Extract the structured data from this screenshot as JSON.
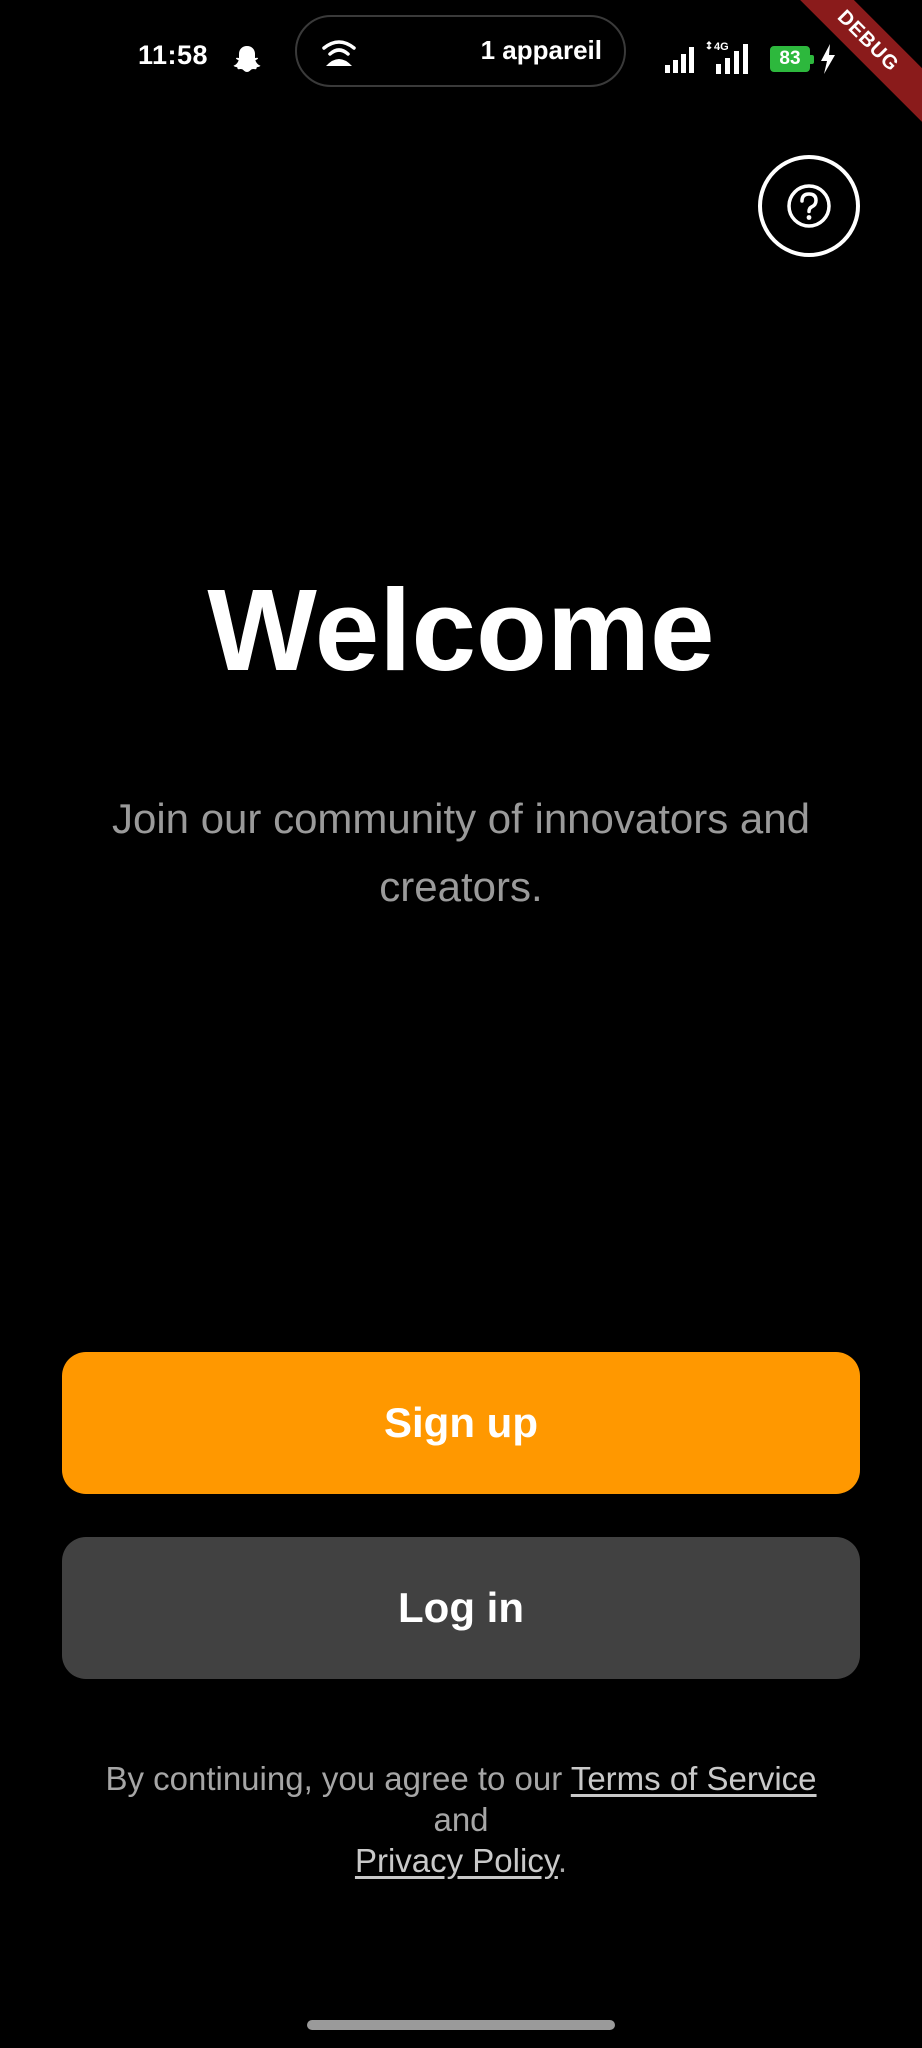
{
  "status_bar": {
    "time": "11:58",
    "hotspot_label": "1 appareil",
    "network_type": "4G",
    "battery_level": "83",
    "battery_color": "#2db83d"
  },
  "debug_banner": "DEBUG",
  "help": {
    "icon": "help-circle-icon"
  },
  "hero": {
    "title": "Welcome",
    "subtitle": "Join our community of innovators and creators."
  },
  "actions": {
    "signup_label": "Sign up",
    "signup_color": "#ff9800",
    "login_label": "Log in",
    "login_color": "#414141"
  },
  "legal": {
    "prefix": "By continuing, you agree to our ",
    "terms_link": "Terms of Service",
    "connector": "and",
    "privacy_link": "Privacy Policy",
    "suffix": "."
  }
}
